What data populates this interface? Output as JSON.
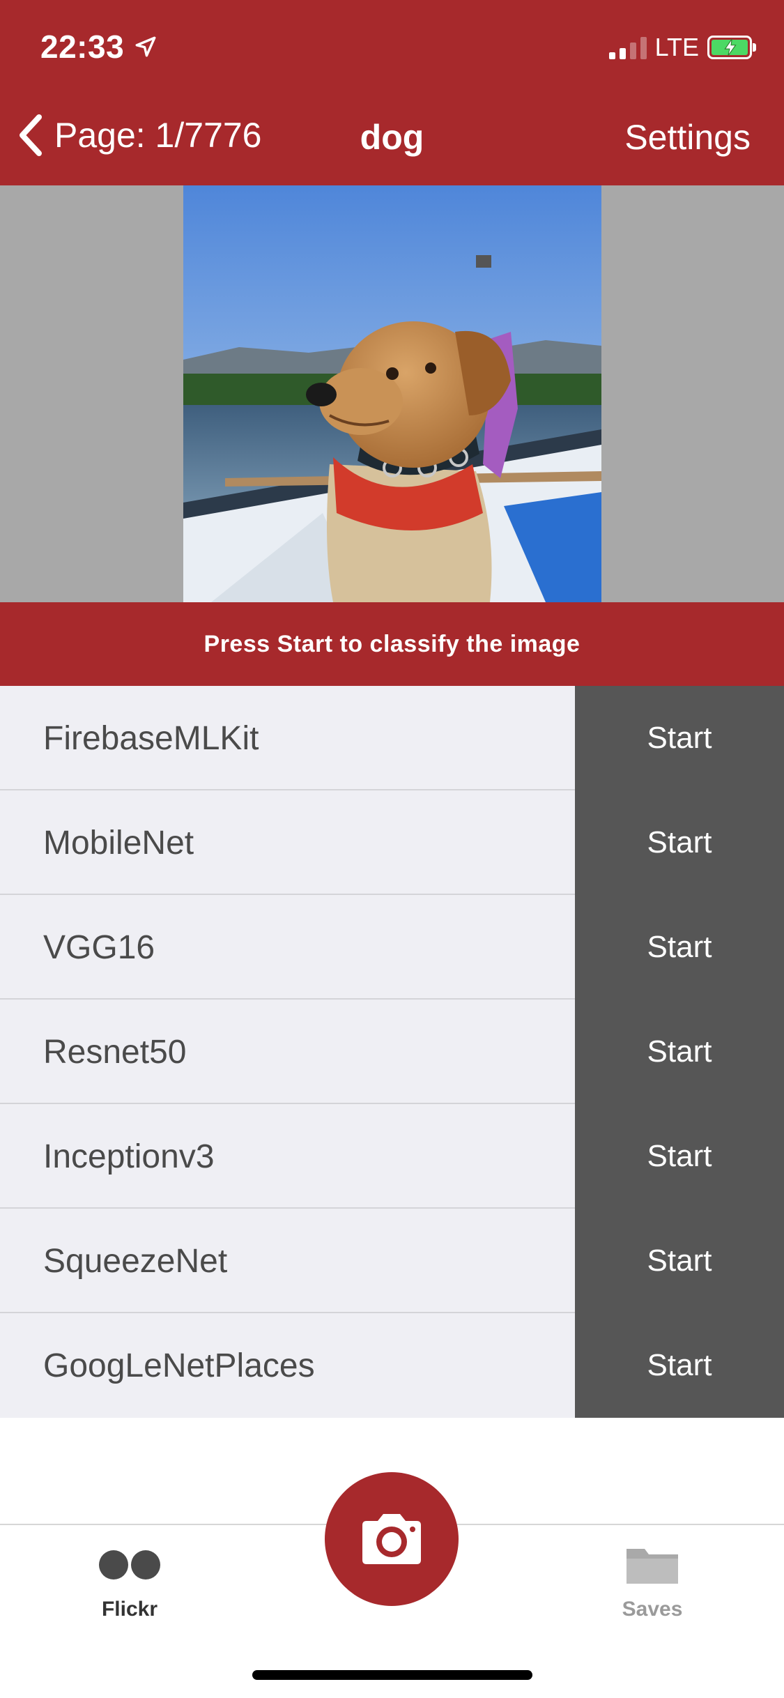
{
  "status_bar": {
    "time": "22:33",
    "network": "LTE",
    "battery_color": "#4cd964"
  },
  "nav": {
    "back_label": "Page: 1/7776",
    "title": "dog",
    "right_label": "Settings"
  },
  "photo": {
    "subject": "dog"
  },
  "banner": {
    "text": "Press Start to classify the image"
  },
  "models": [
    {
      "name": "FirebaseMLKit",
      "action": "Start"
    },
    {
      "name": "MobileNet",
      "action": "Start"
    },
    {
      "name": "VGG16",
      "action": "Start"
    },
    {
      "name": "Resnet50",
      "action": "Start"
    },
    {
      "name": "Inceptionv3",
      "action": "Start"
    },
    {
      "name": "SqueezeNet",
      "action": "Start"
    },
    {
      "name": "GoogLeNetPlaces",
      "action": "Start"
    }
  ],
  "tabbar": {
    "left_label": "Flickr",
    "left_icon": "flickr-icon",
    "center_icon": "camera-icon",
    "right_label": "Saves",
    "right_icon": "folder-icon"
  },
  "colors": {
    "brand_red": "#a7292c",
    "button_gray": "#565656",
    "row_bg": "#efeff4"
  }
}
